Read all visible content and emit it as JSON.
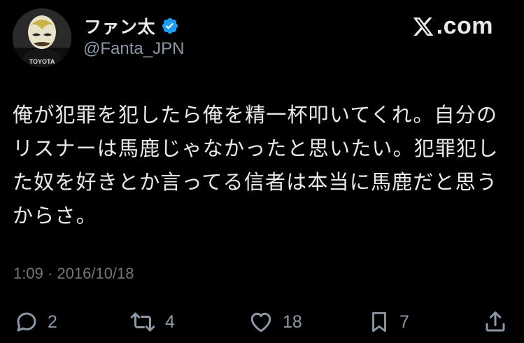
{
  "author": {
    "display_name": "ファン太",
    "handle": "@Fanta_JPN",
    "verified": true,
    "avatar_text": "TOYOTA"
  },
  "brand": {
    "label": ".com",
    "icon": "x-logo-icon"
  },
  "tweet": {
    "lines": [
      "俺が犯罪を犯したら俺を精一杯叩いてくれ。自分の",
      "リスナーは馬鹿じゃなかったと思いたい。犯罪犯し",
      "た奴を好きとか言ってる信者は本当に馬鹿だと思う",
      "からさ。"
    ],
    "time": "1:09",
    "separator": "·",
    "date": "2016/10/18"
  },
  "actions": {
    "reply_count": "2",
    "retweet_count": "4",
    "like_count": "18",
    "bookmark_count": "7"
  },
  "colors": {
    "background": "#000000",
    "text": "#e7e9ea",
    "secondary": "#8b98a5",
    "verified": "#1d9bf0"
  }
}
